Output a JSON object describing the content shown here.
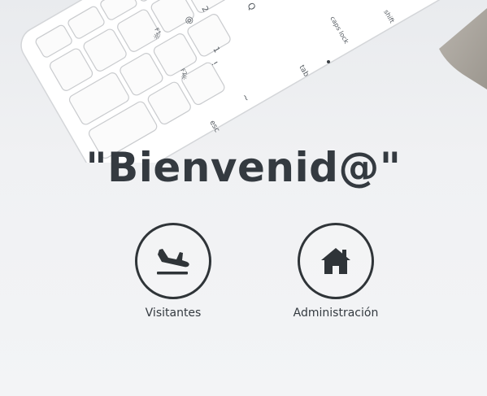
{
  "hero": {
    "title": "\"Bienvenid@\"",
    "background_color": "#f1f2f4",
    "text_color": "#343a40"
  },
  "keyboard": {
    "keys": {
      "esc": "esc",
      "tab": "tab",
      "caps_lock": "caps lock",
      "shift": "shift",
      "tilde": "~",
      "backtick": "`",
      "one": "1",
      "exclaim": "!",
      "two": "2",
      "at": "@",
      "q": "Q",
      "f1": "F1",
      "f2": "F2"
    }
  },
  "options": [
    {
      "label": "Visitantes",
      "icon": "plane-landing-icon"
    },
    {
      "label": "Administración",
      "icon": "home-icon"
    }
  ]
}
